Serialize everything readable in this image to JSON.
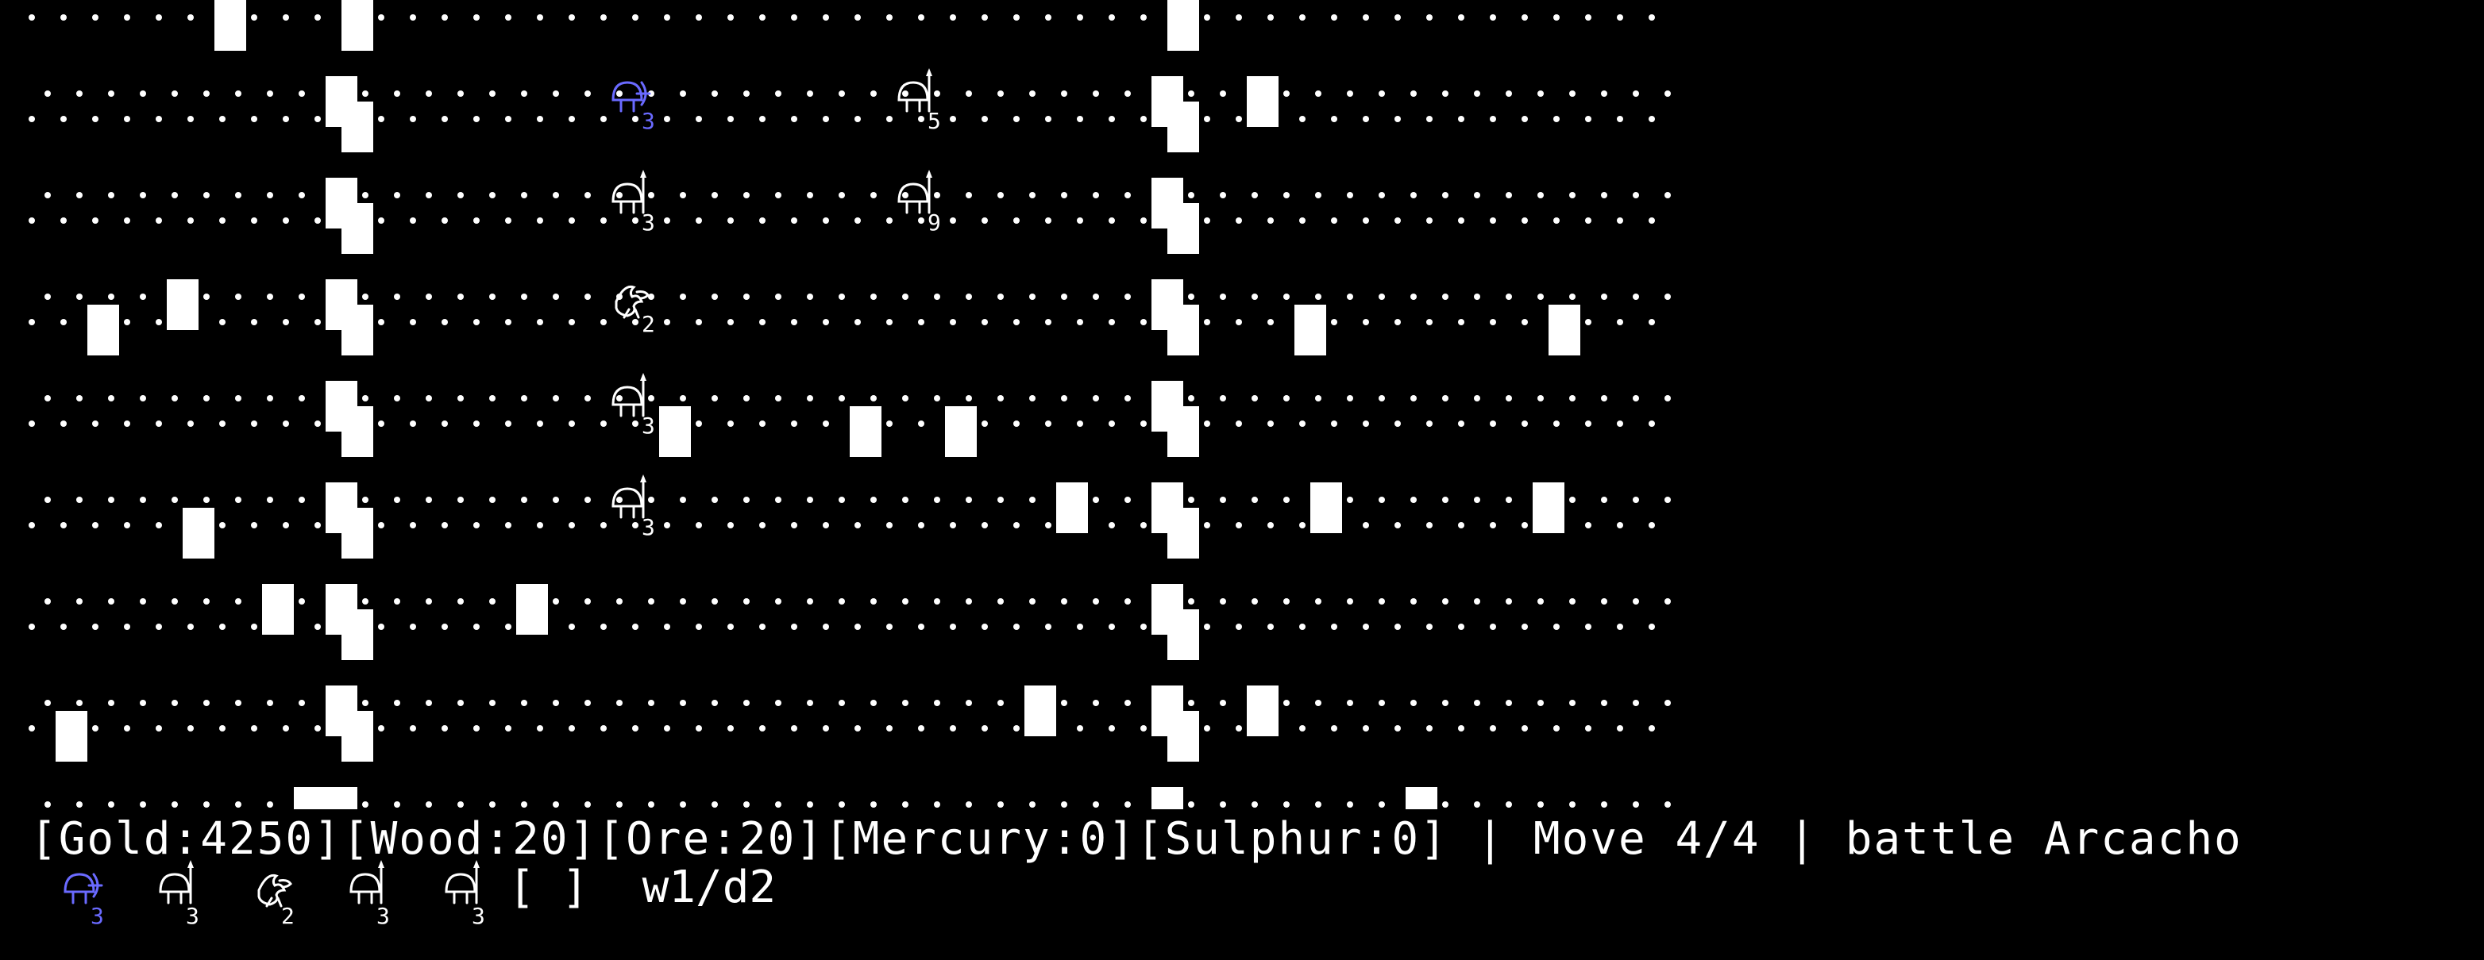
{
  "colors": {
    "background": "#000000",
    "grid_dot": "#ffffff",
    "wall": "#ffffff",
    "active_unit": "#6a6aff",
    "unit": "#ffffff",
    "status_text": "#ffffff"
  },
  "board": {
    "columns": 52,
    "rows": 16,
    "obstacle_cells": [
      [
        0,
        6
      ],
      [
        0,
        10
      ],
      [
        0,
        36
      ],
      [
        1,
        9
      ],
      [
        1,
        35
      ],
      [
        1,
        38
      ],
      [
        2,
        10
      ],
      [
        2,
        36
      ],
      [
        3,
        9
      ],
      [
        3,
        35
      ],
      [
        4,
        10
      ],
      [
        4,
        36
      ],
      [
        5,
        4
      ],
      [
        5,
        9
      ],
      [
        5,
        35
      ],
      [
        6,
        2
      ],
      [
        6,
        10
      ],
      [
        6,
        36
      ],
      [
        6,
        40
      ],
      [
        6,
        48
      ],
      [
        7,
        9
      ],
      [
        7,
        35
      ],
      [
        8,
        10
      ],
      [
        8,
        20
      ],
      [
        8,
        26
      ],
      [
        8,
        29
      ],
      [
        8,
        36
      ],
      [
        9,
        9
      ],
      [
        9,
        32
      ],
      [
        9,
        35
      ],
      [
        9,
        40
      ],
      [
        9,
        47
      ],
      [
        10,
        5
      ],
      [
        10,
        10
      ],
      [
        10,
        36
      ],
      [
        11,
        7
      ],
      [
        11,
        9
      ],
      [
        11,
        15
      ],
      [
        11,
        35
      ],
      [
        12,
        10
      ],
      [
        12,
        36
      ],
      [
        13,
        9
      ],
      [
        13,
        31
      ],
      [
        13,
        35
      ],
      [
        13,
        38
      ],
      [
        14,
        1
      ],
      [
        14,
        10
      ],
      [
        14,
        36
      ],
      [
        15,
        8
      ],
      [
        15,
        9
      ],
      [
        15,
        35
      ],
      [
        15,
        43
      ]
    ],
    "units": [
      {
        "row": 1,
        "col": 18,
        "icon": "crossbowman-icon",
        "count": "3",
        "active": true
      },
      {
        "row": 1,
        "col": 27,
        "icon": "pikeman-icon",
        "count": "5",
        "active": false
      },
      {
        "row": 3,
        "col": 18,
        "icon": "pikeman-icon",
        "count": "3",
        "active": false
      },
      {
        "row": 3,
        "col": 27,
        "icon": "pikeman-icon",
        "count": "9",
        "active": false
      },
      {
        "row": 5,
        "col": 18,
        "icon": "griffin-icon",
        "count": "2",
        "active": false
      },
      {
        "row": 7,
        "col": 18,
        "icon": "pikeman-icon",
        "count": "3",
        "active": false
      },
      {
        "row": 9,
        "col": 18,
        "icon": "pikeman-icon",
        "count": "3",
        "active": false
      }
    ]
  },
  "status_bar": {
    "text": "[Gold:4250][Wood:20][Ore:20][Mercury:0][Sulphur:0] | Move 4/4 | battle Arcacho"
  },
  "turn_queue": {
    "units": [
      {
        "icon": "crossbowman-icon",
        "count": "3",
        "active": true
      },
      {
        "icon": "pikeman-icon",
        "count": "3",
        "active": false
      },
      {
        "icon": "griffin-icon",
        "count": "2",
        "active": false
      },
      {
        "icon": "pikeman-icon",
        "count": "3",
        "active": false
      },
      {
        "icon": "pikeman-icon",
        "count": "3",
        "active": false
      }
    ],
    "tail_text": "[ ]  w1/d2"
  }
}
